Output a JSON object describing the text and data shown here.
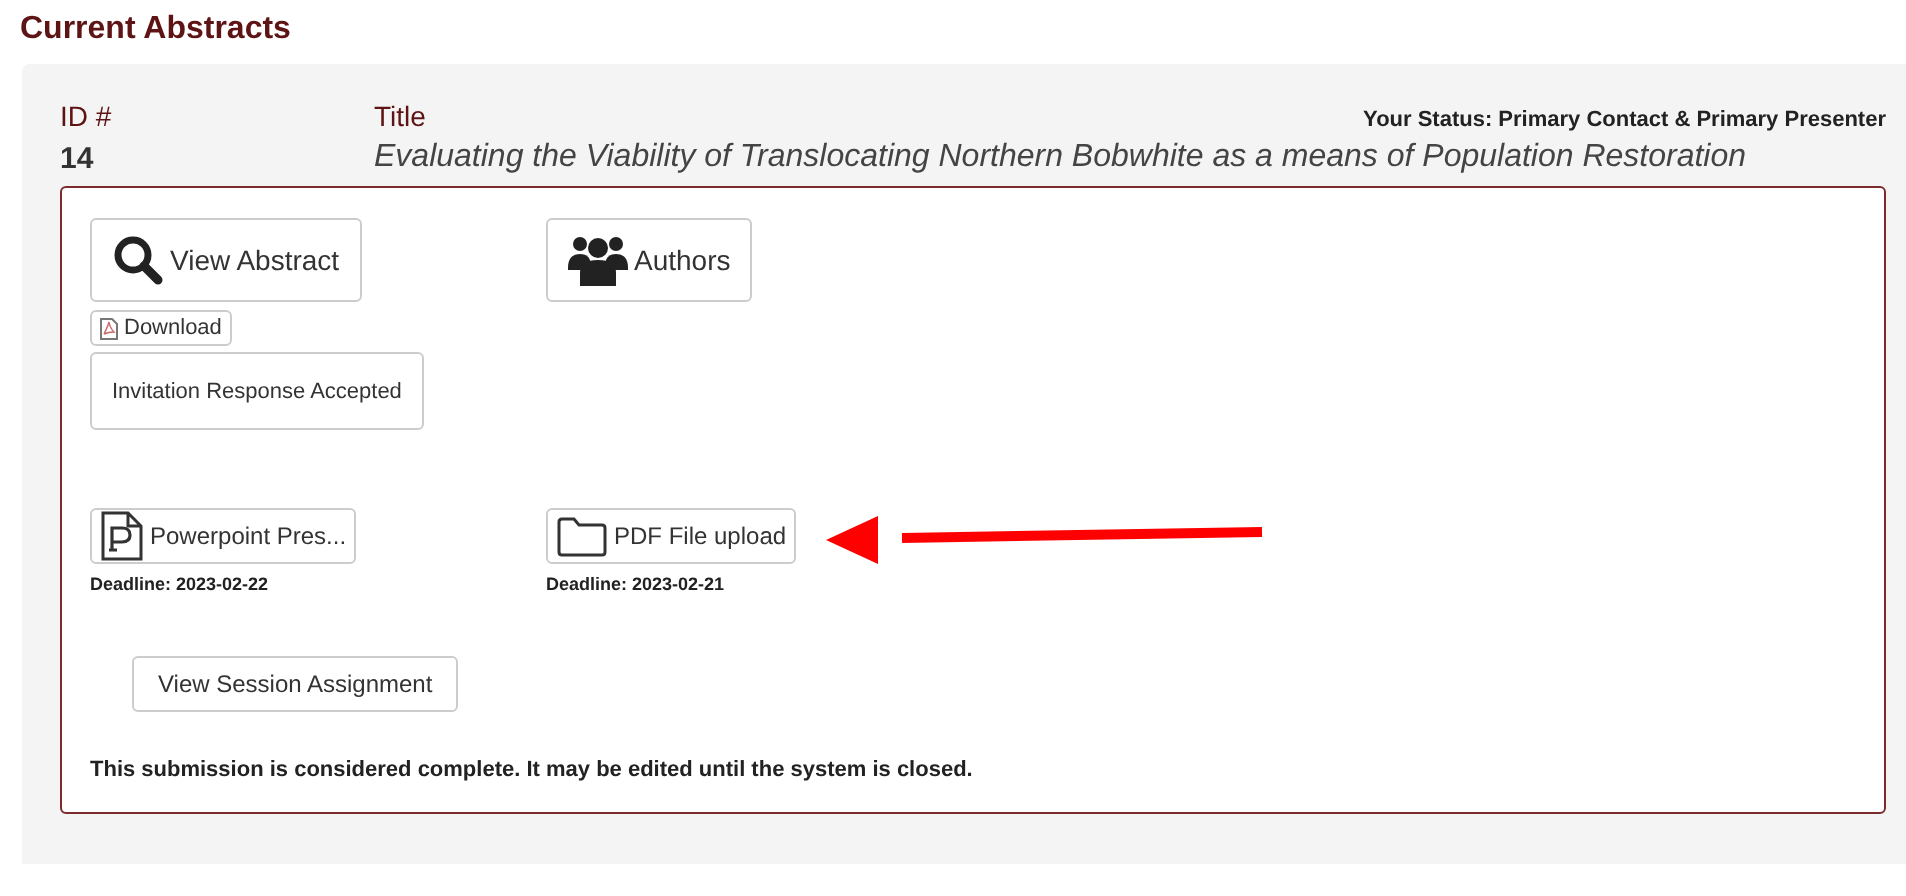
{
  "heading": "Current Abstracts",
  "abstract": {
    "id_label": "ID #",
    "title_label": "Title",
    "status": "Your Status: Primary Contact & Primary Presenter",
    "id": "14",
    "title": "Evaluating the Viability of Translocating Northern Bobwhite as a means of Population Restoration",
    "actions": [
      {
        "label": "View Abstract",
        "kind": "view"
      },
      {
        "label": "Authors",
        "kind": "authors"
      }
    ],
    "download": "Download",
    "invitation": "Invitation Response Accepted",
    "uploads": [
      {
        "label": "Powerpoint Pres...",
        "kind": "powerpoint",
        "deadline": "Deadline: 2023-02-22"
      },
      {
        "label": "PDF File upload",
        "kind": "pdf",
        "deadline": "Deadline: 2023-02-21"
      }
    ],
    "session_button": "View Session Assignment",
    "note": "This submission is considered complete. It may be edited until the system is closed."
  }
}
